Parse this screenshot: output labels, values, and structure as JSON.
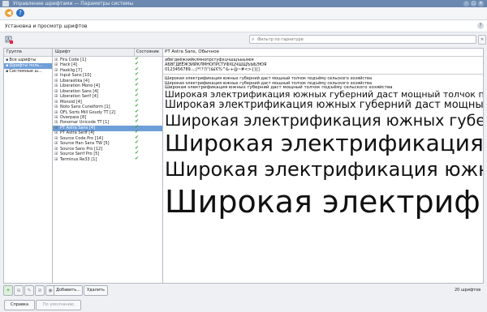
{
  "window": {
    "title": "Управление шрифтами — Параметры системы"
  },
  "header": {
    "title": "Установка и просмотр шрифтов"
  },
  "filter": {
    "placeholder": "Фильтр по гарнитуре"
  },
  "groups": {
    "column": "Группа",
    "items": [
      "Все шрифты",
      "Шрифты поль...",
      "Системные ш..."
    ]
  },
  "fonts": {
    "col_font": "Шрифт",
    "col_state": "Состояние",
    "items": [
      "Fira Code [1]",
      "Hack [4]",
      "Hasklig [7]",
      "Input Sans [10]",
      "Liberastika [4]",
      "Liberation Mono [4]",
      "Liberation Sans [4]",
      "Liberation Serif [4]",
      "Monoid [4]",
      "Noto Sans Cuneiform [1]",
      "OFL Sorts Mill Goudy TT [2]",
      "Overpass [8]",
      "Ponomar Unicode TT [1]",
      "PT Astra Sans [4]",
      "PT Astra Serif [4]",
      "Source Code Pro [14]",
      "Source Han Sans TW [5]",
      "Source Sans Pro [12]",
      "Source Serif Pro [5]",
      "Terminus Re33 [1]"
    ],
    "selected_index": 13
  },
  "preview": {
    "font_name": "PT Astra Sans, Обычное",
    "lowercase": "абвгдеёжзийклмнопрстуфхцчшщъыьэюя",
    "uppercase": "АБВГДЕЁЖЗИЙКЛМНОПРСТУФХЦЧШЩЪЫЬЭЮЯ",
    "digits": "0123456789.:,;(*!?'/\\\")$£€%^&-+@~#<>{}[]",
    "sample": "Широкая электрификация южных губерний даст мощный толчок подъёму сельского хозяйства",
    "sizes": [
      5,
      5,
      5,
      10,
      13,
      19,
      25,
      22,
      37
    ]
  },
  "buttons": {
    "add": "Добавить...",
    "delete": "Удалить",
    "help": "Справка",
    "defaults": "По умолчанию"
  },
  "status": {
    "count": "20 шрифтов"
  },
  "icons": {
    "back": "back-arrow-icon",
    "forward": "forward-arrow-icon",
    "install": "font-install-icon",
    "search": "search-icon",
    "clear": "clear-icon"
  },
  "colors": {
    "accent": "#6f9fd8",
    "titlebar": "#6b89b0",
    "check": "#3aa63a"
  }
}
